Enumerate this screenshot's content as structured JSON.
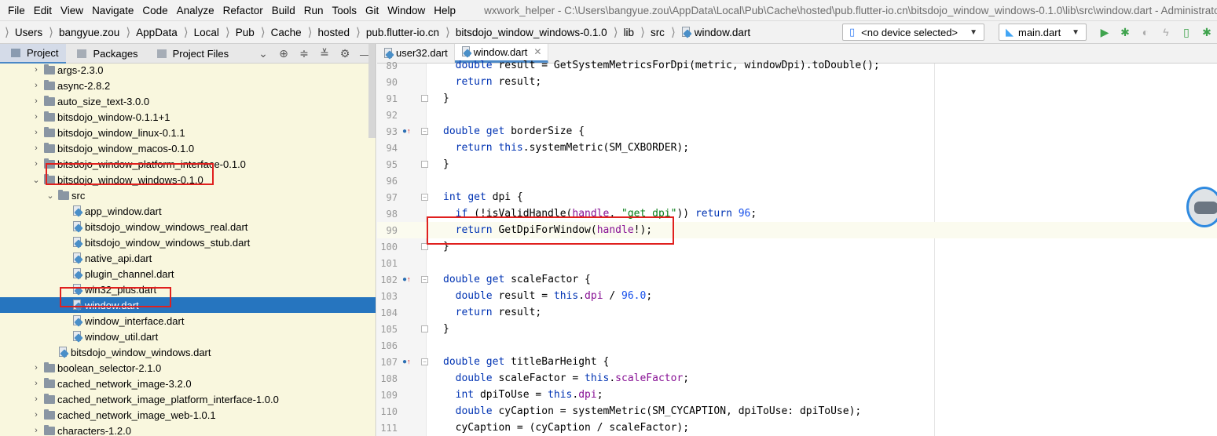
{
  "menubar": {
    "items": [
      "File",
      "Edit",
      "View",
      "Navigate",
      "Code",
      "Analyze",
      "Refactor",
      "Build",
      "Run",
      "Tools",
      "Git",
      "Window",
      "Help"
    ],
    "window_title": "wxwork_helper - C:\\Users\\bangyue.zou\\AppData\\Local\\Pub\\Cache\\hosted\\pub.flutter-io.cn\\bitsdojo_window_windows-0.1.0\\lib\\src\\window.dart - Administrator"
  },
  "breadcrumb": [
    "Users",
    "bangyue.zou",
    "AppData",
    "Local",
    "Pub",
    "Cache",
    "hosted",
    "pub.flutter-io.cn",
    "bitsdojo_window_windows-0.1.0",
    "lib",
    "src",
    "window.dart"
  ],
  "toolbar": {
    "device_selector": "<no device selected>",
    "run_config": "main.dart"
  },
  "project_panel": {
    "tabs": [
      "Project",
      "Packages",
      "Project Files"
    ],
    "tree": [
      {
        "label": "args-2.3.0",
        "type": "folder",
        "depth": 0,
        "expanded": false
      },
      {
        "label": "async-2.8.2",
        "type": "folder",
        "depth": 0,
        "expanded": false
      },
      {
        "label": "auto_size_text-3.0.0",
        "type": "folder",
        "depth": 0,
        "expanded": false
      },
      {
        "label": "bitsdojo_window-0.1.1+1",
        "type": "folder",
        "depth": 0,
        "expanded": false
      },
      {
        "label": "bitsdojo_window_linux-0.1.1",
        "type": "folder",
        "depth": 0,
        "expanded": false
      },
      {
        "label": "bitsdojo_window_macos-0.1.0",
        "type": "folder",
        "depth": 0,
        "expanded": false
      },
      {
        "label": "bitsdojo_window_platform_interface-0.1.0",
        "type": "folder",
        "depth": 0,
        "expanded": false
      },
      {
        "label": "bitsdojo_window_windows-0.1.0",
        "type": "folder",
        "depth": 0,
        "expanded": true
      },
      {
        "label": "src",
        "type": "folder",
        "depth": 1,
        "expanded": true
      },
      {
        "label": "app_window.dart",
        "type": "file",
        "depth": 2
      },
      {
        "label": "bitsdojo_window_windows_real.dart",
        "type": "file",
        "depth": 2
      },
      {
        "label": "bitsdojo_window_windows_stub.dart",
        "type": "file",
        "depth": 2
      },
      {
        "label": "native_api.dart",
        "type": "file",
        "depth": 2
      },
      {
        "label": "plugin_channel.dart",
        "type": "file",
        "depth": 2
      },
      {
        "label": "win32_plus.dart",
        "type": "file",
        "depth": 2
      },
      {
        "label": "window.dart",
        "type": "file",
        "depth": 2,
        "selected": true
      },
      {
        "label": "window_interface.dart",
        "type": "file",
        "depth": 2
      },
      {
        "label": "window_util.dart",
        "type": "file",
        "depth": 2
      },
      {
        "label": "bitsdojo_window_windows.dart",
        "type": "file",
        "depth": 1
      },
      {
        "label": "boolean_selector-2.1.0",
        "type": "folder",
        "depth": 0,
        "expanded": false
      },
      {
        "label": "cached_network_image-3.2.0",
        "type": "folder",
        "depth": 0,
        "expanded": false
      },
      {
        "label": "cached_network_image_platform_interface-1.0.0",
        "type": "folder",
        "depth": 0,
        "expanded": false
      },
      {
        "label": "cached_network_image_web-1.0.1",
        "type": "folder",
        "depth": 0,
        "expanded": false
      },
      {
        "label": "characters-1.2.0",
        "type": "folder",
        "depth": 0,
        "expanded": false
      }
    ]
  },
  "editor": {
    "tabs": [
      {
        "label": "user32.dart",
        "active": false
      },
      {
        "label": "window.dart",
        "active": true
      }
    ],
    "lines": [
      {
        "n": "89",
        "text": "  double result = GetSystemMetricsForDpi(metric, windowDpi).toDouble();"
      },
      {
        "n": "90",
        "text": "  return result;"
      },
      {
        "n": "91",
        "text": "}"
      },
      {
        "n": "92",
        "text": ""
      },
      {
        "n": "93",
        "text": "double get borderSize {",
        "marker": true
      },
      {
        "n": "94",
        "text": "  return this.systemMetric(SM_CXBORDER);"
      },
      {
        "n": "95",
        "text": "}"
      },
      {
        "n": "96",
        "text": ""
      },
      {
        "n": "97",
        "text": "int get dpi {"
      },
      {
        "n": "98",
        "text": "  if (!isValidHandle(handle, \"get dpi\")) return 96;"
      },
      {
        "n": "99",
        "text": "  return GetDpiForWindow(handle!);",
        "current": true
      },
      {
        "n": "100",
        "text": "}"
      },
      {
        "n": "101",
        "text": ""
      },
      {
        "n": "102",
        "text": "double get scaleFactor {",
        "marker": true
      },
      {
        "n": "103",
        "text": "  double result = this.dpi / 96.0;"
      },
      {
        "n": "104",
        "text": "  return result;"
      },
      {
        "n": "105",
        "text": "}"
      },
      {
        "n": "106",
        "text": ""
      },
      {
        "n": "107",
        "text": "double get titleBarHeight {",
        "marker": true
      },
      {
        "n": "108",
        "text": "  double scaleFactor = this.scaleFactor;"
      },
      {
        "n": "109",
        "text": "  int dpiToUse = this.dpi;"
      },
      {
        "n": "110",
        "text": "  double cyCaption = systemMetric(SM_CYCAPTION, dpiToUse: dpiToUse);"
      },
      {
        "n": "111",
        "text": "  cyCaption = (cyCaption / scaleFactor);"
      }
    ]
  },
  "colors": {
    "selection": "#2675bf",
    "highlight_box": "#e0201e",
    "tree_bg": "#f9f7de",
    "keyword": "#0033b3",
    "field": "#871094",
    "number": "#1750eb",
    "string": "#067d17"
  }
}
